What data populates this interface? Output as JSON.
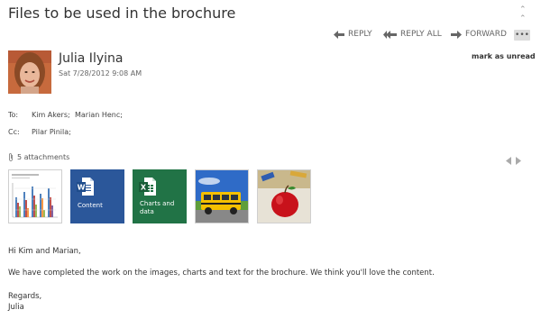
{
  "message": {
    "subject": "Files to be used in the brochure",
    "sender": "Julia Ilyina",
    "sent": "Sat 7/28/2012 9:08 AM"
  },
  "actions": {
    "reply": "REPLY",
    "reply_all": "REPLY ALL",
    "forward": "FORWARD",
    "more": "•••",
    "mark_unread": "mark as unread"
  },
  "recipients": {
    "to_label": "To:",
    "to": [
      "Kim Akers;",
      "Marian Henc;"
    ],
    "cc_label": "Cc:",
    "cc": [
      "Pilar Pinila;"
    ]
  },
  "attachments": {
    "count_label": "5 attachments",
    "items": [
      {
        "kind": "chart-image",
        "label": ""
      },
      {
        "kind": "word-document",
        "label": "Content",
        "color": "#2b579a"
      },
      {
        "kind": "excel-workbook",
        "label": "Charts and data",
        "color": "#217346"
      },
      {
        "kind": "school-bus-image",
        "label": ""
      },
      {
        "kind": "apple-image",
        "label": ""
      }
    ]
  },
  "body": {
    "greeting": "Hi Kim and Marian,",
    "line": "We have completed the work on the images, charts and text for the brochure. We think you'll love the content.",
    "regards": "Regards,",
    "signature": "Julia"
  },
  "colors": {
    "accent_arrow": "#666666",
    "word": "#2b579a",
    "excel": "#217346"
  }
}
